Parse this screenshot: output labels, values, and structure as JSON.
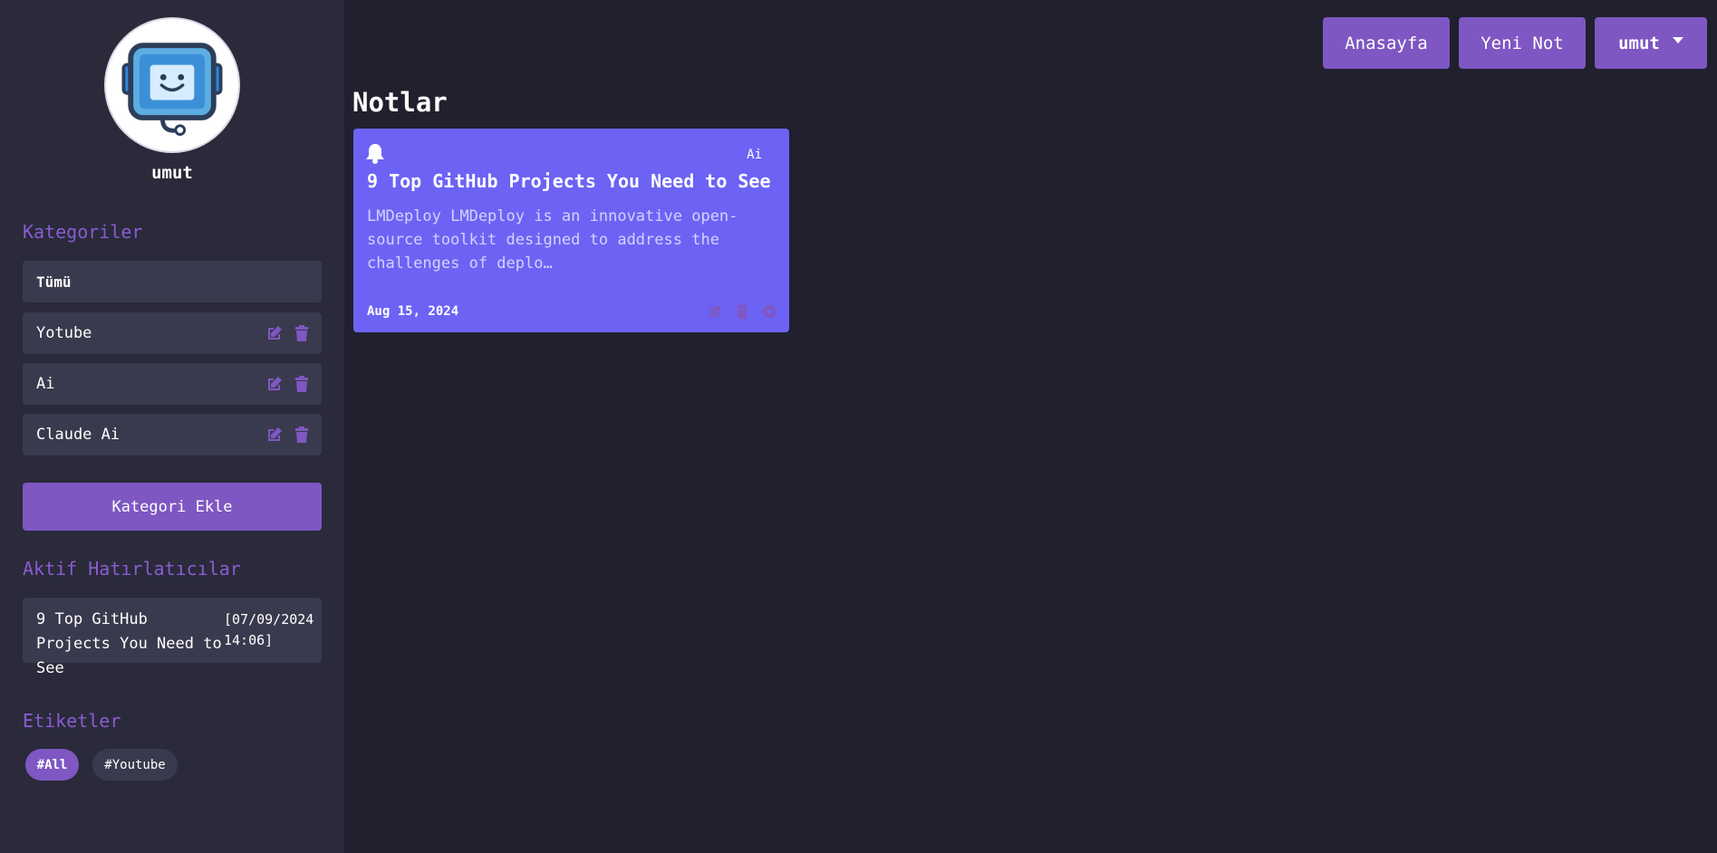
{
  "colors": {
    "background": "#20202e",
    "sidebar": "#2a2a3b",
    "item": "#3a3a4e",
    "accent": "#7e57c2",
    "card": "#6c63f5"
  },
  "sidebar": {
    "username": "umut",
    "categories_title": "Kategoriler",
    "categories": [
      {
        "label": "Tümü",
        "editable": false
      },
      {
        "label": "Yotube",
        "editable": true
      },
      {
        "label": "Ai",
        "editable": true
      },
      {
        "label": "Claude Ai",
        "editable": true
      }
    ],
    "add_category_label": "Kategori Ekle",
    "reminders_title": "Aktif Hatırlatıcılar",
    "reminders": [
      {
        "title": "9 Top GitHub Projects You Need to See",
        "date": "[07/09/2024 14:06]"
      }
    ],
    "tags_title": "Etiketler",
    "tags": [
      "#All",
      "#Youtube"
    ]
  },
  "header": {
    "home_label": "Anasayfa",
    "new_note_label": "Yeni Not",
    "user_menu_label": "umut"
  },
  "main": {
    "title": "Notlar",
    "notes": [
      {
        "category": "Ai",
        "title": "9 Top GitHub Projects You Need to See",
        "excerpt": "LMDeploy LMDeploy is an innovative open-source toolkit designed to address the challenges of deplo…",
        "date": "Aug 15, 2024"
      }
    ]
  }
}
